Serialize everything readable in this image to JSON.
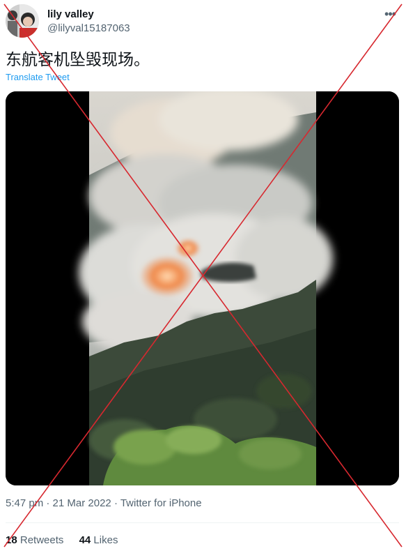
{
  "author": {
    "display_name": "lily valley",
    "handle": "@lilyval15187063"
  },
  "tweet": {
    "text": "东航客机坠毁现场。",
    "translate_label": "Translate Tweet"
  },
  "meta": {
    "time": "5:47 pm",
    "separator": " · ",
    "date": "21 Mar 2022",
    "source": "Twitter for iPhone"
  },
  "stats": {
    "retweets_count": "18",
    "retweets_label": "Retweets",
    "likes_count": "44",
    "likes_label": "Likes"
  },
  "icons": {
    "more": "more-options-icon"
  },
  "colors": {
    "cross_mark": "#d7282f",
    "link": "#1d9bf0",
    "secondary_text": "#536471"
  }
}
